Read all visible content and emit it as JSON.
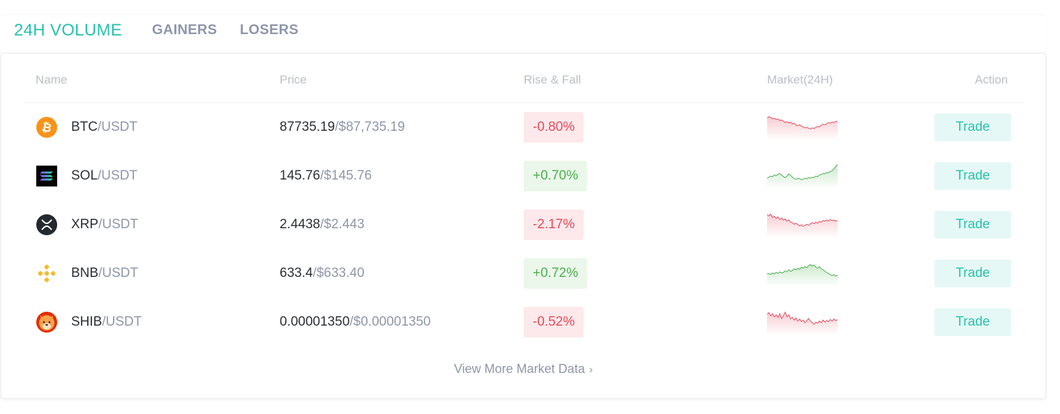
{
  "tabs": {
    "volume": "24H VOLUME",
    "gainers": "GAINERS",
    "losers": "LOSERS",
    "active": "volume"
  },
  "table": {
    "headers": {
      "name": "Name",
      "price": "Price",
      "change": "Rise & Fall",
      "market": "Market(24H)",
      "action": "Action"
    },
    "rows": [
      {
        "base": "BTC",
        "quote": "/USDT",
        "price": "87735.19",
        "price_usd": "/$87,735.19",
        "change": "-0.80%",
        "direction": "down",
        "icon": "bitcoin-icon",
        "trade_label": "Trade",
        "spark": [
          0.78,
          0.82,
          0.8,
          0.74,
          0.76,
          0.72,
          0.74,
          0.68,
          0.7,
          0.66,
          0.6,
          0.64,
          0.58,
          0.62,
          0.55,
          0.58,
          0.5,
          0.48,
          0.52,
          0.46,
          0.44,
          0.4,
          0.42,
          0.38,
          0.36,
          0.4,
          0.38,
          0.42,
          0.46,
          0.44,
          0.5,
          0.54,
          0.52,
          0.56,
          0.6,
          0.58,
          0.62,
          0.6,
          0.64,
          0.66
        ]
      },
      {
        "base": "SOL",
        "quote": "/USDT",
        "price": "145.76",
        "price_usd": "/$145.76",
        "change": "+0.70%",
        "direction": "up",
        "icon": "solana-icon",
        "trade_label": "Trade",
        "spark": [
          0.34,
          0.38,
          0.42,
          0.4,
          0.46,
          0.44,
          0.48,
          0.52,
          0.46,
          0.4,
          0.36,
          0.42,
          0.5,
          0.44,
          0.38,
          0.32,
          0.3,
          0.34,
          0.32,
          0.28,
          0.3,
          0.34,
          0.32,
          0.36,
          0.34,
          0.38,
          0.36,
          0.42,
          0.4,
          0.46,
          0.48,
          0.52,
          0.5,
          0.56,
          0.54,
          0.6,
          0.62,
          0.7,
          0.78,
          0.86
        ]
      },
      {
        "base": "XRP",
        "quote": "/USDT",
        "price": "2.4438",
        "price_usd": "/$2.443",
        "change": "-2.17%",
        "direction": "down",
        "icon": "xrp-icon",
        "trade_label": "Trade",
        "spark": [
          0.8,
          0.76,
          0.82,
          0.7,
          0.74,
          0.66,
          0.72,
          0.62,
          0.68,
          0.6,
          0.64,
          0.56,
          0.6,
          0.52,
          0.5,
          0.44,
          0.48,
          0.42,
          0.38,
          0.42,
          0.36,
          0.4,
          0.44,
          0.4,
          0.46,
          0.5,
          0.46,
          0.52,
          0.48,
          0.54,
          0.52,
          0.58,
          0.56,
          0.6,
          0.56,
          0.62,
          0.58,
          0.6,
          0.56,
          0.58
        ]
      },
      {
        "base": "BNB",
        "quote": "/USDT",
        "price": "633.4",
        "price_usd": "/$633.40",
        "change": "+0.72%",
        "direction": "up",
        "icon": "bnb-icon",
        "trade_label": "Trade",
        "spark": [
          0.4,
          0.42,
          0.38,
          0.44,
          0.4,
          0.46,
          0.42,
          0.48,
          0.44,
          0.46,
          0.52,
          0.48,
          0.56,
          0.5,
          0.54,
          0.6,
          0.56,
          0.62,
          0.58,
          0.66,
          0.62,
          0.68,
          0.64,
          0.72,
          0.76,
          0.7,
          0.74,
          0.66,
          0.62,
          0.68,
          0.6,
          0.56,
          0.5,
          0.46,
          0.42,
          0.38,
          0.34,
          0.38,
          0.32,
          0.36
        ]
      },
      {
        "base": "SHIB",
        "quote": "/USDT",
        "price": "0.00001350",
        "price_usd": "/$0.00001350",
        "change": "-0.52%",
        "direction": "down",
        "icon": "shiba-inu-icon",
        "trade_label": "Trade",
        "spark": [
          0.72,
          0.78,
          0.66,
          0.74,
          0.62,
          0.7,
          0.6,
          0.74,
          0.56,
          0.66,
          0.8,
          0.62,
          0.7,
          0.54,
          0.6,
          0.5,
          0.58,
          0.46,
          0.54,
          0.44,
          0.5,
          0.4,
          0.48,
          0.56,
          0.46,
          0.4,
          0.34,
          0.42,
          0.38,
          0.46,
          0.4,
          0.5,
          0.42,
          0.48,
          0.44,
          0.52,
          0.46,
          0.54,
          0.48,
          0.52
        ]
      }
    ]
  },
  "footer": {
    "view_more": "View More Market Data",
    "chevron": "›"
  },
  "colors": {
    "accent": "#27c2ad",
    "down": "#e54b5c",
    "up": "#4caf50",
    "muted": "#8e96aa"
  }
}
